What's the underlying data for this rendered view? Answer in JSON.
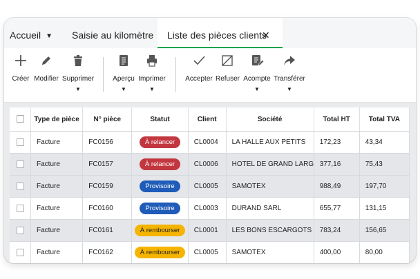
{
  "tabs": {
    "dropdown_label": "Accueil",
    "tab2_label": "Saisie au kilomètre",
    "tab3_label": "Liste des pièces clients",
    "close_glyph": "✕"
  },
  "toolbar": {
    "create": "Créer",
    "modify": "Modifier",
    "delete": "Supprimer",
    "preview": "Aperçu",
    "print": "Imprimer",
    "accept": "Accepter",
    "refuse": "Refuser",
    "deposit": "Acompte",
    "transfer": "Transférer"
  },
  "table": {
    "headers": {
      "type": "Type de pièce",
      "num": "N° pièce",
      "status": "Statut",
      "client": "Client",
      "company": "Société",
      "ht": "Total HT",
      "tva": "Total TVA"
    },
    "rows": [
      {
        "type": "Facture",
        "num": "FC0156",
        "status": "À relancer",
        "client": "CL0004",
        "company": "LA HALLE AUX PETITS",
        "ht": "172,23",
        "tva": "43,34"
      },
      {
        "type": "Facture",
        "num": "FC0157",
        "status": "À relancer",
        "client": "CL0006",
        "company": "HOTEL DE GRAND LARGE",
        "ht": "377,16",
        "tva": "75,43"
      },
      {
        "type": "Facture",
        "num": "FC0159",
        "status": "Provisoire",
        "client": "CL0005",
        "company": "SAMOTEX",
        "ht": "988,49",
        "tva": "197,70"
      },
      {
        "type": "Facture",
        "num": "FC0160",
        "status": "Provisoire",
        "client": "CL0003",
        "company": "DURAND SARL",
        "ht": "655,77",
        "tva": "131,15"
      },
      {
        "type": "Facture",
        "num": "FC0161",
        "status": "À rembourser",
        "client": "CL0001",
        "company": "LES BONS ESCARGOTS",
        "ht": "783,24",
        "tva": "156,65"
      },
      {
        "type": "Facture",
        "num": "FC0162",
        "status": "À rembourser",
        "client": "CL0005",
        "company": "SAMOTEX",
        "ht": "400,00",
        "tva": "80,00"
      }
    ]
  },
  "colors": {
    "accent_green": "#00a14b",
    "status_relancer": "#c2373f",
    "status_provisoire": "#1f5bb8",
    "status_rembourser": "#f5b400"
  }
}
